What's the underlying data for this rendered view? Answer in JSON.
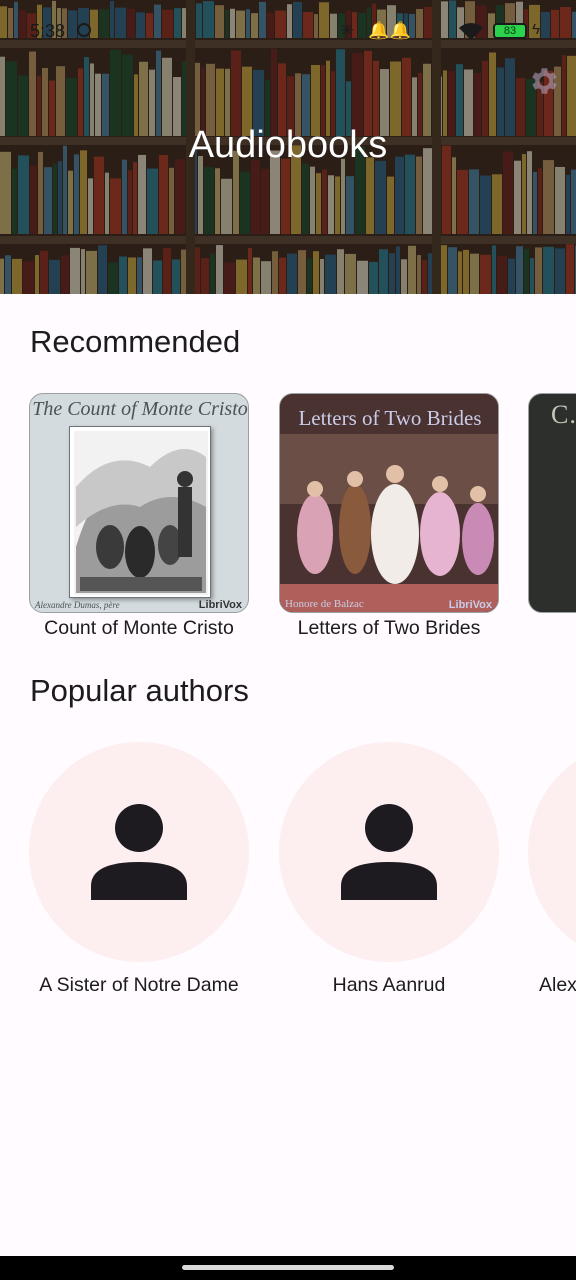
{
  "status_bar": {
    "time": "5:38",
    "center_text": "✳   🔔🔔",
    "battery_level": "83",
    "icons": [
      "sync-icon",
      "bluetooth-icon",
      "wifi-icon",
      "battery-icon",
      "charging-icon"
    ]
  },
  "header": {
    "title": "Audiobooks",
    "settings_icon": "gear-icon"
  },
  "recommended": {
    "title": "Recommended",
    "books": [
      {
        "label": "Count of Monte Cristo",
        "cover_title": "The Count of Monte Cristo",
        "cover_author": "Alexandre Dumas, père",
        "cover_brand": "LibriVox"
      },
      {
        "label": "Letters of Two Brides",
        "cover_title": "Letters of Two Brides",
        "cover_author": "Honore de Balzac",
        "cover_brand": "LibriVox"
      },
      {
        "label": "",
        "cover_title": "C… Bl…",
        "cover_author": "",
        "cover_brand": ""
      }
    ]
  },
  "popular_authors": {
    "title": "Popular authors",
    "authors": [
      {
        "label": "A Sister of Notre Dame",
        "icon": "person-icon"
      },
      {
        "label": "Hans Aanrud",
        "icon": "person-icon"
      },
      {
        "label": "Alex",
        "icon": "person-icon"
      }
    ]
  },
  "colors": {
    "background": "#fffbfe",
    "avatar_bg": "#fdeef0",
    "text": "#1d1b20",
    "battery": "#2bd24b"
  }
}
